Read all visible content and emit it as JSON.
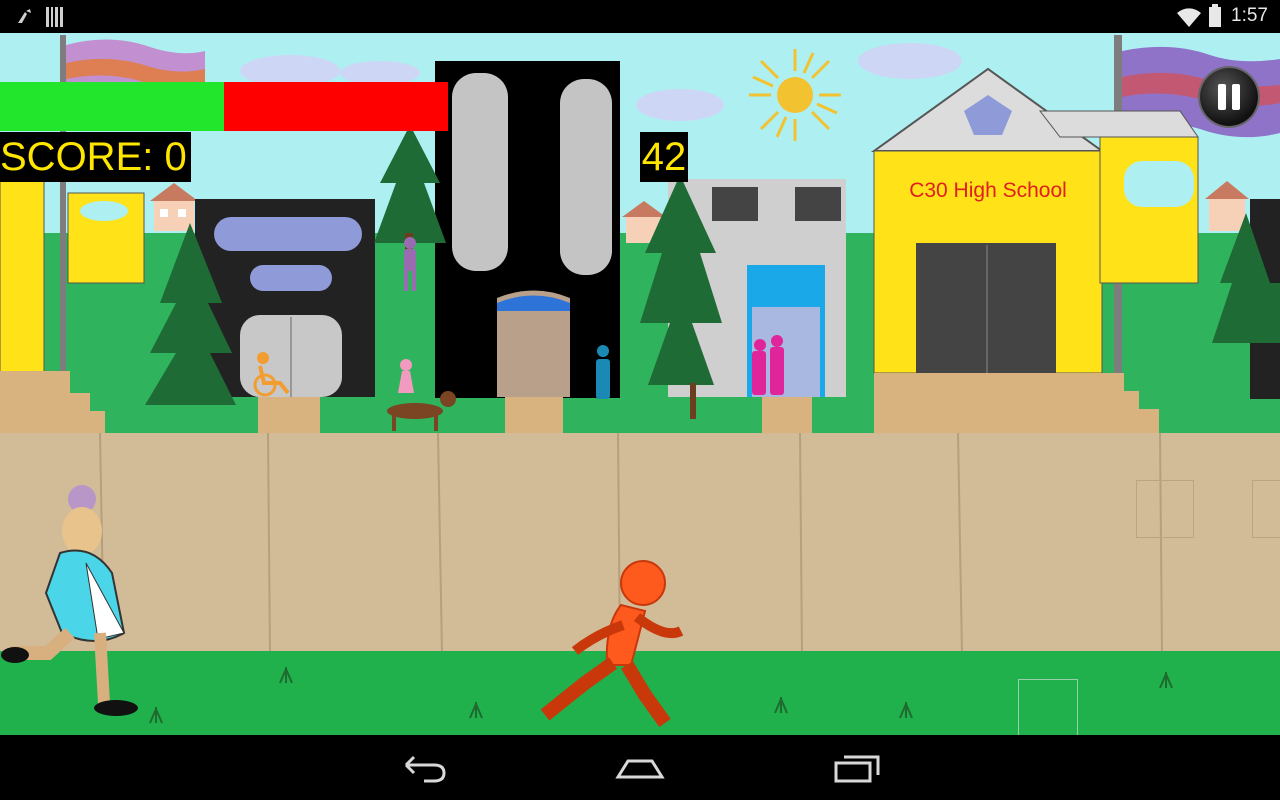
{
  "status_bar": {
    "time": "1:57",
    "icons": [
      "usb-debug-icon",
      "barcode-icon",
      "wifi-icon",
      "battery-icon"
    ]
  },
  "hud": {
    "score_text": "SCORE: 0",
    "timer_value": "42",
    "health_fraction": 0.5,
    "health_color": "#22e62c",
    "damage_color": "#ff0000",
    "text_color": "#ffe600",
    "pause_icon": "pause-icon"
  },
  "scene": {
    "school_sign": "C30 High School",
    "sky_color": "#aef0f2",
    "grass_color": "#20b14c",
    "wall_color": "#d2bb97"
  },
  "characters": [
    "player-runner",
    "chasing-grandma"
  ],
  "nav_bar": {
    "buttons": [
      "back-button",
      "home-button",
      "recent-apps-button"
    ]
  }
}
